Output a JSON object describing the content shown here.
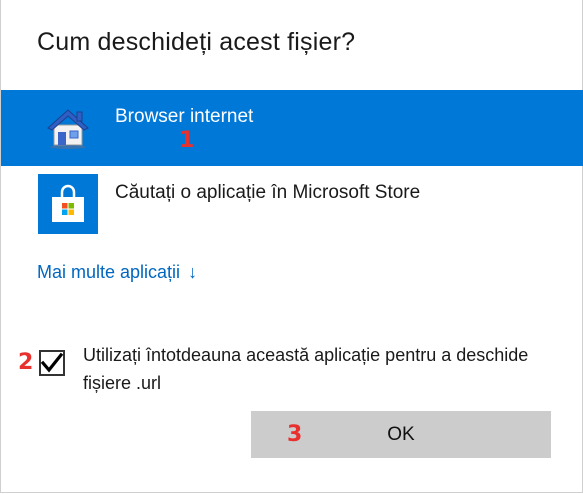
{
  "dialog": {
    "title": "Cum deschideți acest fișier?",
    "apps": [
      {
        "label": "Browser internet",
        "icon": "home-icon",
        "selected": true
      },
      {
        "label": "Căutați o aplicație în Microsoft Store",
        "icon": "store-icon",
        "selected": false
      }
    ],
    "more_apps_link": "Mai multe aplicații",
    "more_apps_chevron": "↓",
    "always_use": {
      "checked": true,
      "label": "Utilizați întotdeauna această aplicație pentru a deschide fișiere .url"
    },
    "ok_label": "OK"
  },
  "markers": {
    "m1": "1",
    "m2": "2",
    "m3": "3"
  },
  "colors": {
    "selection": "#0078d7",
    "link": "#0067c0",
    "marker": "#e8312f",
    "button": "#cccccc"
  }
}
